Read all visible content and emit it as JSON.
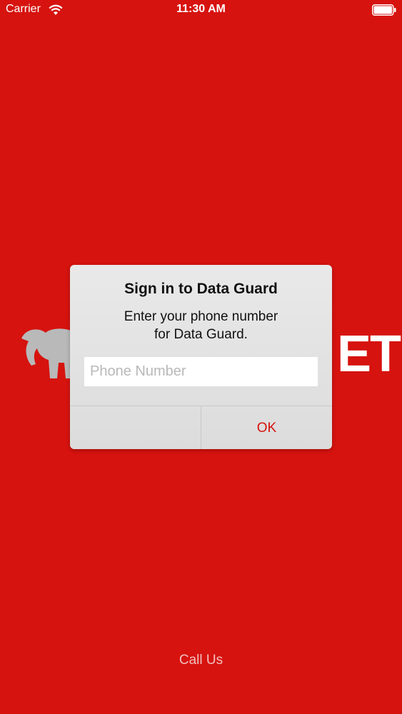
{
  "status_bar": {
    "carrier": "Carrier",
    "time": "11:30 AM",
    "wifi_icon": "wifi-icon",
    "battery_icon": "battery-icon"
  },
  "background": {
    "color": "#d6130f",
    "logo_text": "ET"
  },
  "alert": {
    "title": "Sign in to Data Guard",
    "message_line1": "Enter your phone number",
    "message_line2": "for Data Guard.",
    "input_placeholder": "Phone Number",
    "input_value": "",
    "cancel_label": "",
    "ok_label": "OK",
    "accent_color": "#d6130f"
  },
  "footer": {
    "call_us_label": "Call Us"
  }
}
